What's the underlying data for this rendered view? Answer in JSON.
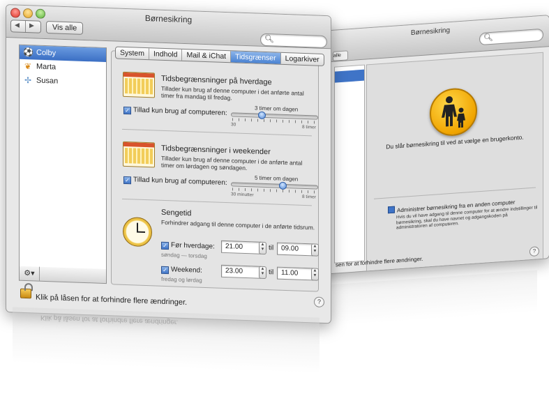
{
  "window_title": "Børnesikring",
  "nav": {
    "back": "◀",
    "forward": "▶",
    "show_all": "Vis alle"
  },
  "search": {
    "placeholder": "",
    "icon": "magnifier-icon"
  },
  "users": [
    {
      "name": "Colby",
      "icon": "soccer-ball-icon",
      "selected": true
    },
    {
      "name": "Marta",
      "icon": "butterfly-icon",
      "selected": false
    },
    {
      "name": "Susan",
      "icon": "dragonfly-icon",
      "selected": false
    }
  ],
  "gear_menu": "⚙▾",
  "tabs": [
    "System",
    "Indhold",
    "Mail & iChat",
    "Tidsgrænser",
    "Logarkiver"
  ],
  "selected_tab": "Tidsgrænser",
  "weekday": {
    "title": "Tidsbegrænsninger på hverdage",
    "desc": "Tillader kun brug af denne computer i det anførte antal timer fra mandag til fredag.",
    "checkbox": "Tillad kun brug af computeren:",
    "value": "3 timer om dagen",
    "min": "30",
    "max": "8 timer",
    "level": 0.36
  },
  "weekend": {
    "title": "Tidsbegrænsninger i weekender",
    "desc": "Tillader kun brug af denne computer i de anførte antal timer om lørdagen og søndagen.",
    "checkbox": "Tillad kun brug af computeren:",
    "value": "5 timer om dagen",
    "min": "30 minutter",
    "max": "8 timer",
    "level": 0.6
  },
  "bedtime": {
    "title": "Sengetid",
    "desc": "Forhindrer adgang til denne computer i de anførte tidsrum.",
    "weekday_label": "Før hverdage:",
    "weekday_sub": "søndag — torsdag",
    "weekday_from": "21.00",
    "weekday_to": "09.00",
    "weekend_label": "Weekend:",
    "weekend_sub": "fredag og lørdag",
    "weekend_from": "23.00",
    "weekend_to": "11.00",
    "til": "til"
  },
  "lock_text": "Klik på låsen for at forhindre flere ændringer.",
  "help": "?",
  "back_window": {
    "title": "Børnesikring",
    "all_btn": "alle",
    "info": "Du slår børnesikring til ved at vælge en brugerkonto.",
    "admin_label": "Administrer børnesikring fra en anden computer",
    "admin_desc": "Hvis du vil have adgang til denne computer for at ændre indstillinger til børnesikring, skal du have navnet og adgangskoden på administratoren af computeren.",
    "lock_text": "sen for at forhindre flere ændringer."
  },
  "reflection_text": "Klik på låsen for at forhindre flere ændringer."
}
